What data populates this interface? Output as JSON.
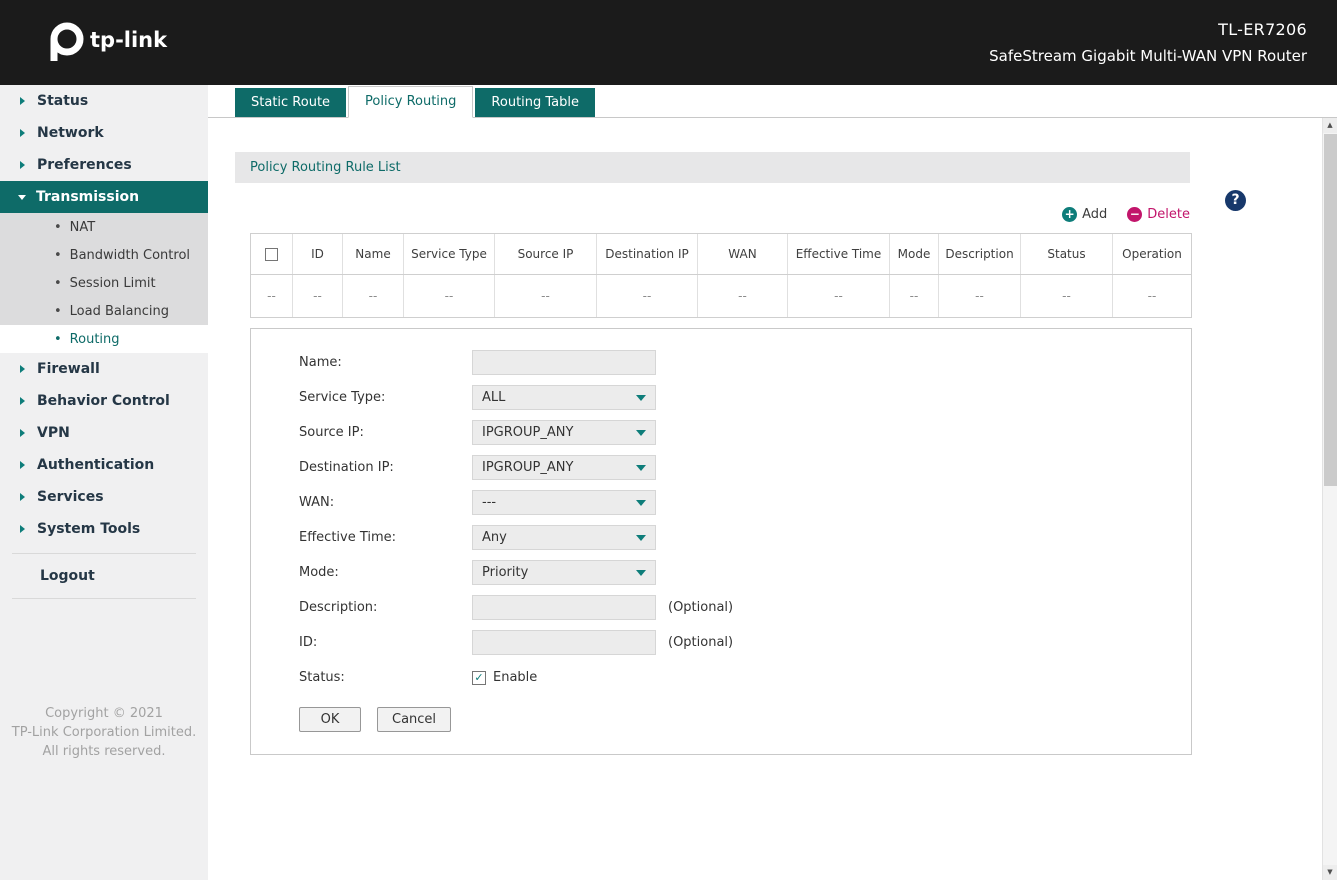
{
  "colors": {
    "teal": "#0e6b68",
    "teal-bright": "#0e7d7a",
    "magenta": "#c2156b",
    "navy": "#17386b",
    "header-bg": "#1b1b1b"
  },
  "icons": {
    "help": "?",
    "add": "+",
    "delete": "−",
    "scroll-up": "▲",
    "scroll-down": "▼",
    "bullet": "•",
    "check": "✓"
  },
  "header": {
    "logo": "tp-link",
    "model": "TL-ER7206",
    "subtitle": "SafeStream Gigabit Multi-WAN VPN Router"
  },
  "sidebar": {
    "items": [
      {
        "label": "Status"
      },
      {
        "label": "Network"
      },
      {
        "label": "Preferences"
      },
      {
        "label": "Transmission"
      },
      {
        "label": "Firewall"
      },
      {
        "label": "Behavior Control"
      },
      {
        "label": "VPN"
      },
      {
        "label": "Authentication"
      },
      {
        "label": "Services"
      },
      {
        "label": "System Tools"
      }
    ],
    "submenu": [
      {
        "label": "NAT"
      },
      {
        "label": "Bandwidth Control"
      },
      {
        "label": "Session Limit"
      },
      {
        "label": "Load Balancing"
      },
      {
        "label": "Routing"
      }
    ],
    "logout": "Logout",
    "copyright": [
      "Copyright © 2021",
      "TP-Link Corporation Limited.",
      "All rights reserved."
    ]
  },
  "tabs": [
    {
      "label": "Static Route"
    },
    {
      "label": "Policy Routing"
    },
    {
      "label": "Routing Table"
    }
  ],
  "section": {
    "title": "Policy Routing Rule List"
  },
  "toolbar": {
    "add": "Add",
    "delete": "Delete"
  },
  "table": {
    "headers": [
      "",
      "ID",
      "Name",
      "Service Type",
      "Source IP",
      "Destination IP",
      "WAN",
      "Effective Time",
      "Mode",
      "Description",
      "Status",
      "Operation"
    ],
    "row": [
      "--",
      "--",
      "--",
      "--",
      "--",
      "--",
      "--",
      "--",
      "--",
      "--",
      "--",
      "--"
    ]
  },
  "form": {
    "name": {
      "label": "Name:",
      "value": ""
    },
    "service_type": {
      "label": "Service Type:",
      "value": "ALL"
    },
    "source_ip": {
      "label": "Source IP:",
      "value": "IPGROUP_ANY"
    },
    "destination_ip": {
      "label": "Destination IP:",
      "value": "IPGROUP_ANY"
    },
    "wan": {
      "label": "WAN:",
      "value": "---"
    },
    "effective_time": {
      "label": "Effective Time:",
      "value": "Any"
    },
    "mode": {
      "label": "Mode:",
      "value": "Priority"
    },
    "description": {
      "label": "Description:",
      "value": "",
      "hint": "(Optional)"
    },
    "id": {
      "label": "ID:",
      "value": "",
      "hint": "(Optional)"
    },
    "status": {
      "label": "Status:",
      "checkbox": "Enable"
    },
    "ok": "OK",
    "cancel": "Cancel"
  }
}
